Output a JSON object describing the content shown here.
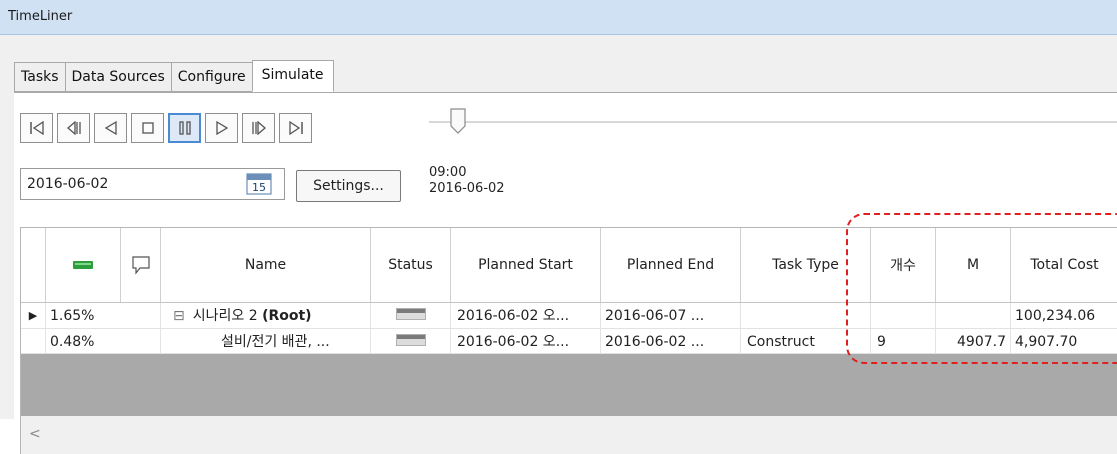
{
  "window": {
    "title": "TimeLiner"
  },
  "tabs": [
    {
      "label": "Tasks"
    },
    {
      "label": "Data Sources"
    },
    {
      "label": "Configure"
    },
    {
      "label": "Simulate"
    }
  ],
  "transport": {
    "buttons": [
      "go-to-start",
      "step-back",
      "play-backward",
      "stop",
      "pause",
      "play",
      "step-forward",
      "go-to-end"
    ],
    "active": "pause"
  },
  "date": {
    "value": "2016-06-02",
    "calendar_day": "15"
  },
  "settings_label": "Settings...",
  "current": {
    "time": "09:00",
    "date": "2016-06-02"
  },
  "table": {
    "headers": [
      "",
      "",
      "",
      "Name",
      "Status",
      "Planned Start",
      "Planned End",
      "Task Type",
      "개수",
      "M",
      "Total Cost"
    ],
    "rows": [
      {
        "selected": true,
        "progress": "1.65%",
        "expander": "⊟",
        "name_prefix": "시나리오 2",
        "name_bold": "(Root)",
        "planned_start": "2016-06-02 오...",
        "planned_end": "2016-06-07 ...",
        "task_type": "",
        "count": "",
        "m": "",
        "total_cost": "100,234.06"
      },
      {
        "selected": false,
        "progress": "0.48%",
        "expander": "",
        "name_prefix": "설비/전기 배관, ...",
        "name_bold": "",
        "planned_start": "2016-06-02 오...",
        "planned_end": "2016-06-02 ...",
        "task_type": "Construct",
        "count": "9",
        "m": "4907.7",
        "total_cost": "4,907.70"
      }
    ]
  },
  "scroll_left": "<",
  "colors": {
    "titlebar": "#cfe1f3",
    "highlight": "#e02020",
    "active_button": "#4a8ad0"
  }
}
